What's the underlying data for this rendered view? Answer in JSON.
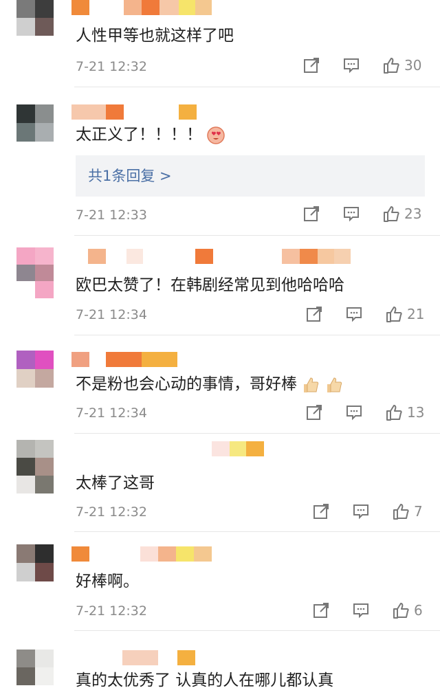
{
  "comments": [
    {
      "text": "人性甲等也就这样了吧",
      "time": "7-21 12:32",
      "likes": "30"
    },
    {
      "text": "太正义了！！！！",
      "time": "7-21 12:33",
      "likes": "23",
      "reply": "共1条回复 >"
    },
    {
      "text": "欧巴太赞了！在韩剧经常见到他哈哈哈",
      "time": "7-21 12:34",
      "likes": "21"
    },
    {
      "text": "不是粉也会心动的事情，哥好棒",
      "time": "7-21 12:34",
      "likes": "13"
    },
    {
      "text": "太棒了这哥",
      "time": "7-21 12:32",
      "likes": "7"
    },
    {
      "text": "好棒啊。",
      "time": "7-21 12:32",
      "likes": "6"
    },
    {
      "text": "真的太优秀了 认真的人在哪儿都认真"
    }
  ],
  "icons": {
    "share": "share-icon",
    "comment": "comment-icon",
    "like": "thumbs-up-icon"
  },
  "colors": {
    "link": "#4a6fa5",
    "meta": "#8a8a8a"
  }
}
